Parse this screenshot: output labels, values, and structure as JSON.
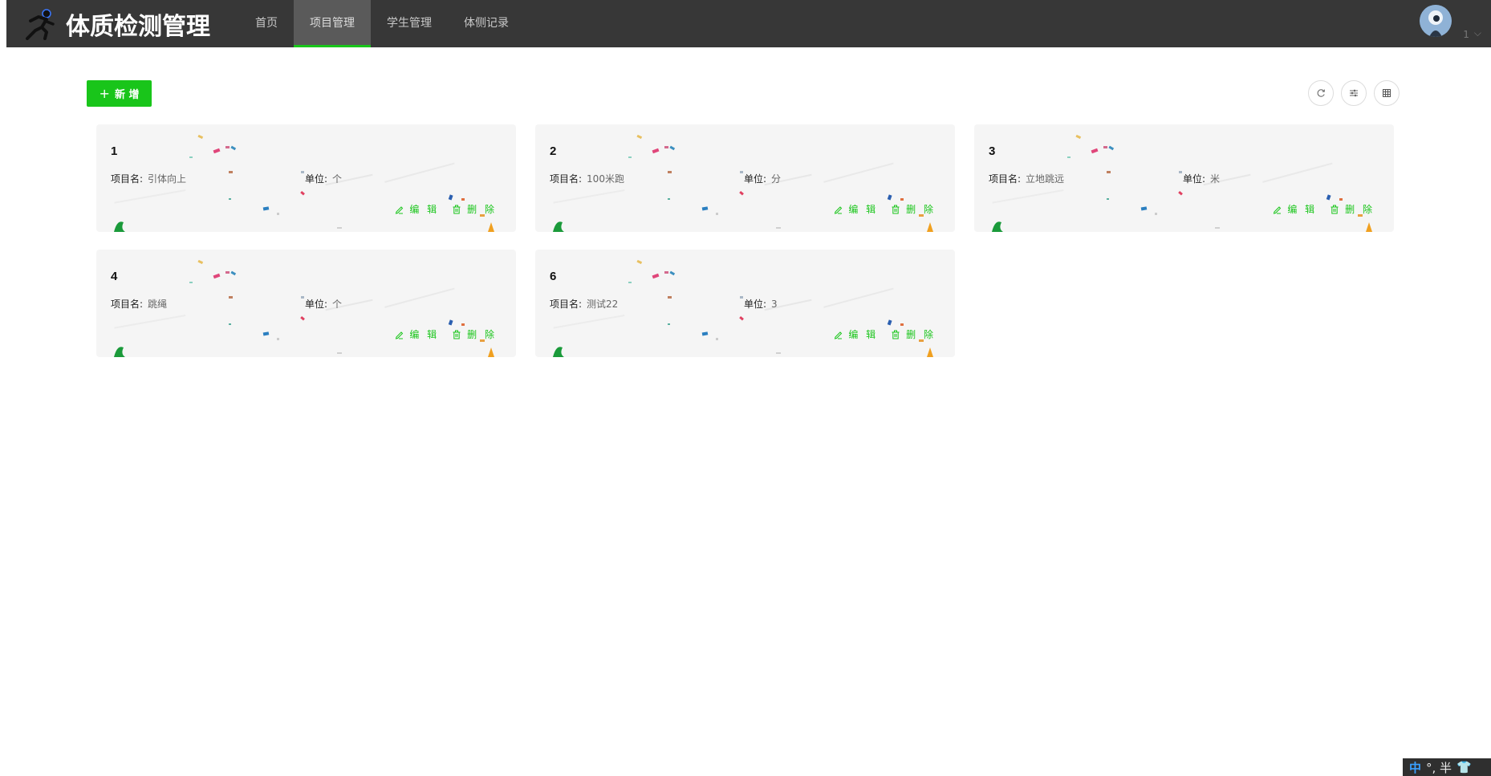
{
  "app": {
    "title": "体质检测管理"
  },
  "nav": [
    {
      "label": "首页",
      "active": false
    },
    {
      "label": "项目管理",
      "active": true
    },
    {
      "label": "学生管理",
      "active": false
    },
    {
      "label": "体侧记录",
      "active": false
    }
  ],
  "user": {
    "name": "1"
  },
  "toolbar": {
    "add_label": "新 增"
  },
  "card_labels": {
    "name_key": "项目名:",
    "unit_key": "单位:",
    "edit": "编 辑",
    "delete": "删 除"
  },
  "cards": [
    {
      "id": "1",
      "name": "引体向上",
      "unit": "个"
    },
    {
      "id": "2",
      "name": "100米跑",
      "unit": "分"
    },
    {
      "id": "3",
      "name": "立地跳远",
      "unit": "米"
    },
    {
      "id": "4",
      "name": "跳绳",
      "unit": "个"
    },
    {
      "id": "6",
      "name": "测试22",
      "unit": "3"
    }
  ],
  "ime": {
    "mode": "中",
    "punct": "°, 半"
  },
  "colors": {
    "accent": "#19c51a",
    "topbar": "#373737",
    "card_bg": "#f5f5f5"
  }
}
